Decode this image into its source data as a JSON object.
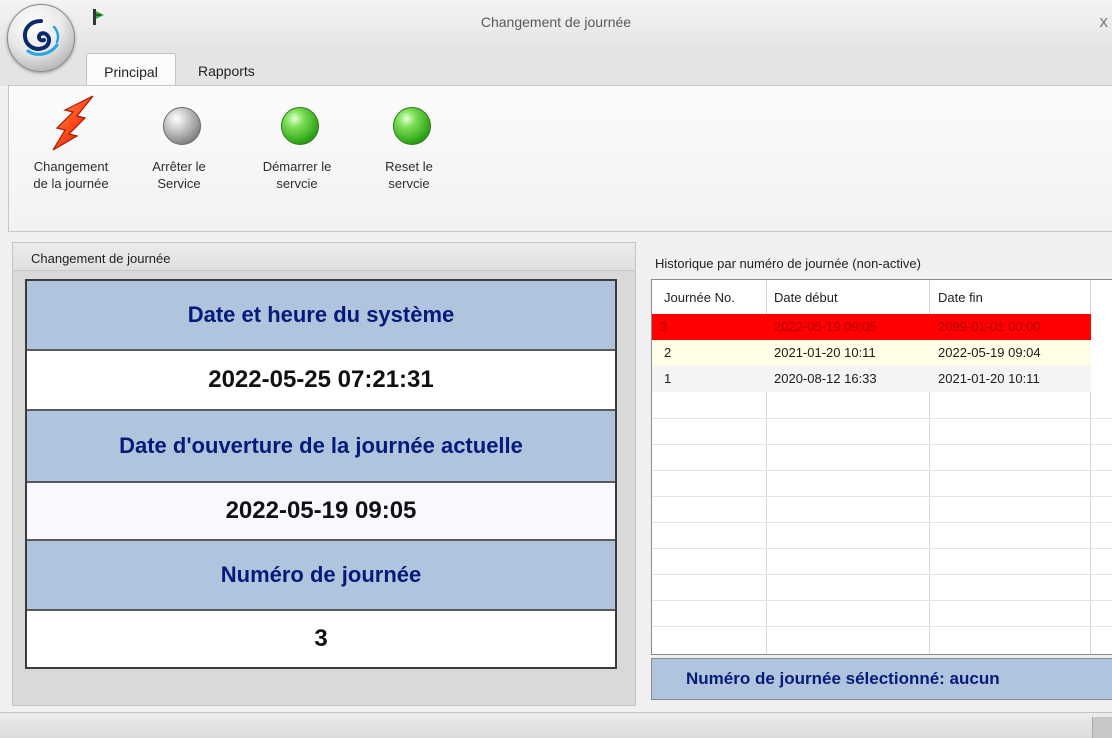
{
  "window": {
    "title": "Changement de journée",
    "close_glyph": "x",
    "app_icon": "app-orb-icon",
    "qat_icon": "pin-icon"
  },
  "tabs": [
    {
      "label": "Principal",
      "active": true
    },
    {
      "label": "Rapports",
      "active": false
    }
  ],
  "ribbon": {
    "buttons": [
      {
        "line1": "Changement",
        "line2": "de la journée",
        "icon": "lightning-arrow-icon"
      },
      {
        "line1": "Arrêter le",
        "line2": "Service",
        "icon": "gray-ball-icon"
      },
      {
        "line1": "Démarrer le",
        "line2": "servcie",
        "icon": "green-ball-icon"
      },
      {
        "line1": "Reset le",
        "line2": "servcie",
        "icon": "green-ball-icon"
      }
    ]
  },
  "left_panel": {
    "header": "Changement de journée",
    "system_datetime_label": "Date et heure du système",
    "system_datetime_value": "2022-05-25 07:21:31",
    "opening_date_label": "Date d'ouverture de la journée actuelle",
    "opening_date_value": "2022-05-19 09:05",
    "day_number_label": "Numéro de journée",
    "day_number_value": "3"
  },
  "history": {
    "label": "Historique par numéro de journée (non-active)",
    "columns": [
      "Journée No.",
      "Date début",
      "Date fin"
    ],
    "rows": [
      {
        "no": "3",
        "start": "2022-05-19 09:05",
        "end": "2099-01-01 00:00",
        "style": "red"
      },
      {
        "no": "2",
        "start": "2021-01-20 10:11",
        "end": "2022-05-19 09:04",
        "style": "yellow"
      },
      {
        "no": "1",
        "start": "2020-08-12 16:33",
        "end": "2021-01-20 10:11",
        "style": "plain"
      }
    ]
  },
  "selected_status": "Numéro de journée sélectionné: aucun",
  "colors": {
    "label_bg": "#b0c4de",
    "label_text": "#061a7a",
    "active_row": "#ff0000",
    "ok_green": "#2fa517"
  }
}
